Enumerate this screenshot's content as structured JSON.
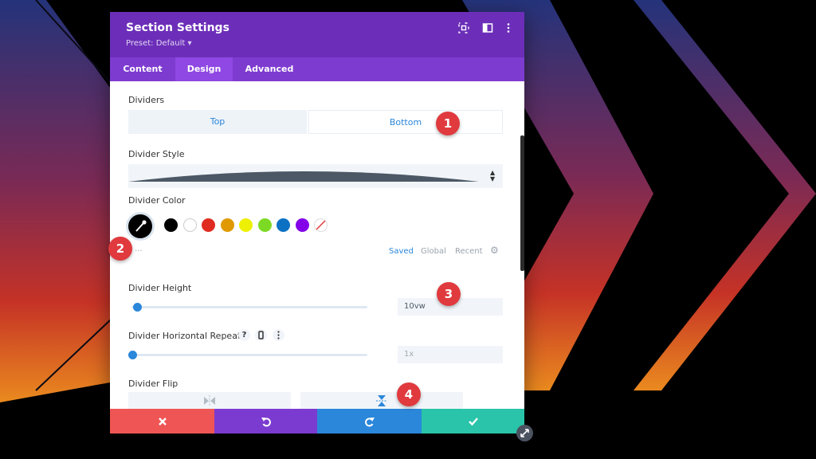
{
  "modal": {
    "title": "Section Settings",
    "preset": "Preset: Default",
    "header_icons": [
      "fullscreen-icon",
      "sidebar-toggle-icon",
      "more-options-icon"
    ],
    "tabs": [
      {
        "label": "Content",
        "active": false
      },
      {
        "label": "Design",
        "active": true
      },
      {
        "label": "Advanced",
        "active": false
      }
    ]
  },
  "settings": {
    "dividers_label": "Dividers",
    "dividers_tabs": [
      "Top",
      "Bottom"
    ],
    "dividers_selected": "Bottom",
    "style_label": "Divider Style",
    "color_label": "Divider Color",
    "swatches": [
      "#000000",
      "#ffffff",
      "#e02b20",
      "#e09900",
      "#edf000",
      "#7cda24",
      "#0c71c3",
      "#8300e9"
    ],
    "color_tabs": {
      "saved": "Saved",
      "global": "Global",
      "recent": "Recent"
    },
    "color_more": "...",
    "height_label": "Divider Height",
    "height_value": "10vw",
    "repeat_label": "Divider Horizontal Repeat",
    "repeat_help": "?",
    "repeat_value": "1x",
    "flip_label": "Divider Flip"
  },
  "footer_actions": [
    "cancel",
    "undo",
    "redo",
    "save"
  ],
  "badges": [
    "1",
    "2",
    "3",
    "4"
  ],
  "colors": {
    "header": "#6c2eb9",
    "tabs": "#7e3bd0",
    "accent": "#2b87da",
    "cancel": "#ef5555",
    "undo": "#7c3bd0",
    "redo": "#2b87da",
    "save": "#29c4a9",
    "badge": "#e03a3e"
  }
}
